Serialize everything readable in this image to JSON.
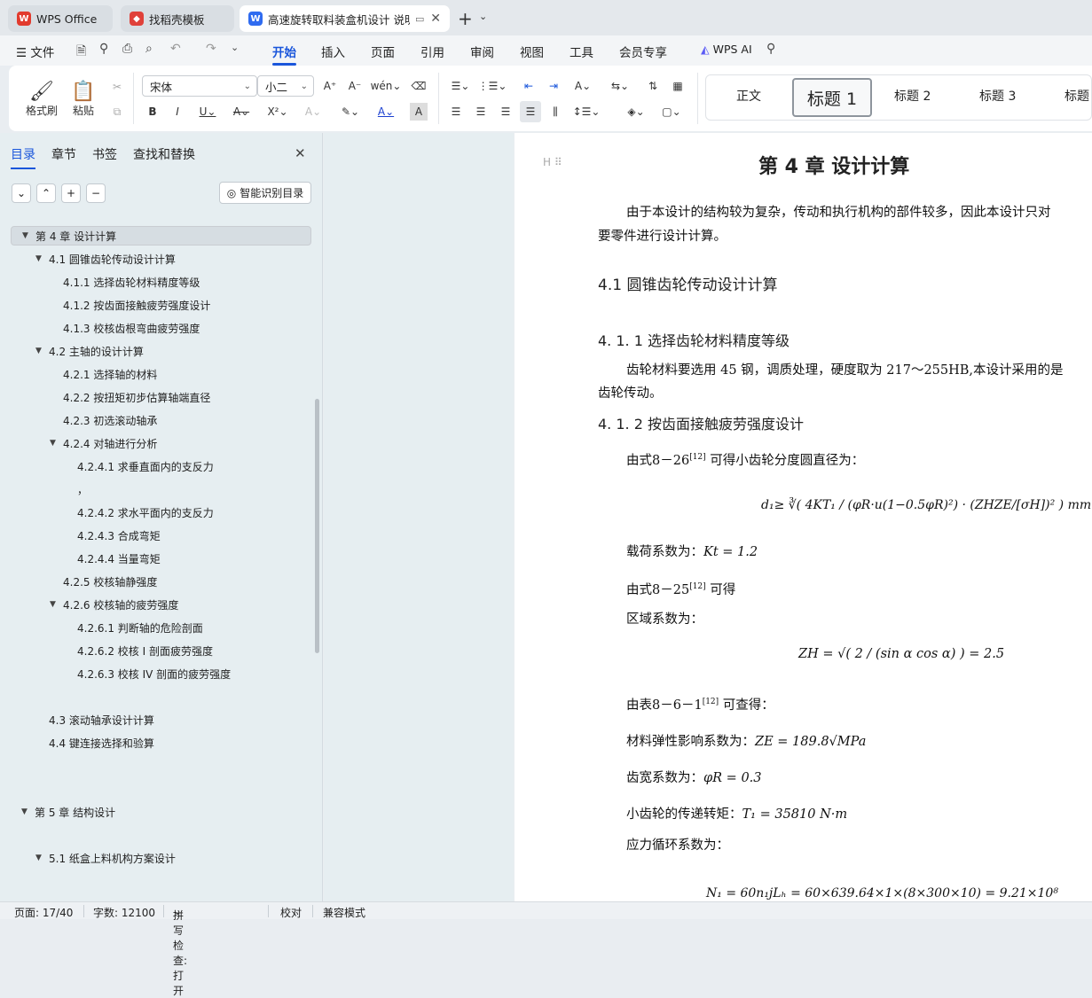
{
  "tabs": [
    {
      "label": "WPS Office"
    },
    {
      "label": "找稻壳模板"
    },
    {
      "label": "高速旋转取料装盒机设计 说明"
    }
  ],
  "menu": {
    "file": "文件",
    "items": [
      "开始",
      "插入",
      "页面",
      "引用",
      "审阅",
      "视图",
      "工具",
      "会员专享"
    ],
    "ai": "WPS AI"
  },
  "ribbon": {
    "format_painter": "格式刷",
    "paste": "粘贴",
    "font": "宋体",
    "size": "小二",
    "styles": [
      "正文",
      "标题 1",
      "标题 2",
      "标题 3",
      "标题"
    ]
  },
  "sidebar": {
    "tabs": [
      "目录",
      "章节",
      "书签",
      "查找和替换"
    ],
    "smart_btn": "智能识别目录",
    "toc": [
      "第 4 章  设计计算",
      "4.1    圆锥齿轮传动设计计算",
      "4.1.1    选择齿轮材料精度等级",
      "4.1.2    按齿面接触疲劳强度设计",
      "4.1.3    校核齿根弯曲疲劳强度",
      "4.2    主轴的设计计算",
      "4.2.1    选择轴的材料",
      "4.2.2    按扭矩初步估算轴端直径",
      "4.2.3    初选滚动轴承",
      "4.2.4    对轴进行分析",
      "4.2.4.1    求垂直面内的支反力",
      "，",
      "4.2.4.2    求水平面内的支反力",
      "4.2.4.3 合成弯矩",
      "4.2.4.4    当量弯矩",
      "4.2.5    校核轴静强度",
      "4.2.6    校核轴的疲劳强度",
      "4.2.6.1    判断轴的危险剖面",
      "4.2.6.2    校核 I 剖面疲劳强度",
      "4.2.6.3    校核 IV 剖面的疲劳强度",
      "4.3    滚动轴承设计计算",
      "4.4    键连接选择和验算",
      "第 5 章    结构设计",
      "5.1    纸盒上料机构方案设计"
    ]
  },
  "document": {
    "chapter": "第 4 章  设计计算",
    "intro1": "由于本设计的结构较为复杂，传动和执行机构的部件较多，因此本设计只对",
    "intro2": "要零件进行设计计算。",
    "h41": "4.1    圆锥齿轮传动设计计算",
    "h411": "4. 1. 1    选择齿轮材料精度等级",
    "p1a": "齿轮材料要选用 45 钢，调质处理，硬度取为 217～255HB,本设计采用的是",
    "p1b": "齿轮传动。",
    "h412": "4. 1. 2    按齿面接触疲劳强度设计",
    "p2": "由式8－26",
    "p2ref": "[12]",
    "p2b": " 可得小齿轮分度圆直径为：",
    "f1": "d₁≥ ∛( 4KT₁ / (φR·u(1−0.5φR)²) · (ZHZE/[σH])² ) mm",
    "p3": "载荷系数为：",
    "p3v": "Kt = 1.2",
    "p4": "由式8－25",
    "p4ref": "[12]",
    "p4b": " 可得",
    "p5": "区域系数为：",
    "f2": "ZH = √( 2 / (sin α cos α) ) = 2.5",
    "p6": "由表8－6－1",
    "p6ref": "[12]",
    "p6b": " 可查得：",
    "p7": "材料弹性影响系数为：",
    "p7v": "ZE = 189.8√MPa",
    "p8": "齿宽系数为：",
    "p8v": "φR = 0.3",
    "p9": "小齿轮的传递转矩：",
    "p9v": "T₁ = 35810 N·m",
    "p10": "应力循环系数为：",
    "f3": "N₁ = 60n₁jLₕ = 60×639.64×1×(8×300×10) = 9.21×10⁸"
  },
  "status": {
    "page": "页面: 17/40",
    "words": "字数: 12100",
    "spell": "拼写检查: 打开",
    "proof": "校对",
    "compat": "兼容模式"
  }
}
